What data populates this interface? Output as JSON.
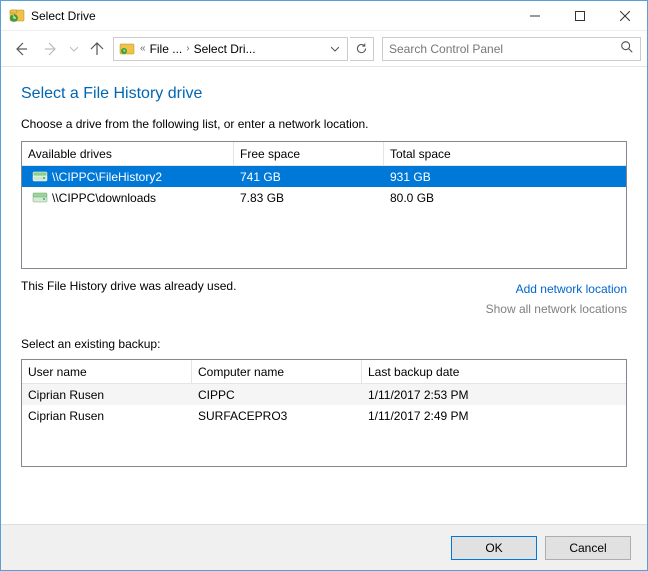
{
  "window": {
    "title": "Select Drive"
  },
  "nav": {
    "breadcrumb_seg1": "File ...",
    "breadcrumb_seg2": "Select Dri...",
    "search_placeholder": "Search Control Panel"
  },
  "page": {
    "title": "Select a File History drive",
    "instruction": "Choose a drive from the following list, or enter a network location."
  },
  "drives": {
    "headers": {
      "c1": "Available drives",
      "c2": "Free space",
      "c3": "Total space"
    },
    "rows": [
      {
        "name": "\\\\CIPPC\\FileHistory2",
        "free": "741 GB",
        "total": "931 GB",
        "selected": true
      },
      {
        "name": "\\\\CIPPC\\downloads",
        "free": "7.83 GB",
        "total": "80.0 GB",
        "selected": false
      }
    ]
  },
  "status": {
    "message": "This File History drive was already used.",
    "add_link": "Add network location",
    "show_link": "Show all network locations"
  },
  "backups": {
    "label": "Select an existing backup:",
    "headers": {
      "c1": "User name",
      "c2": "Computer name",
      "c3": "Last backup date"
    },
    "rows": [
      {
        "user": "Ciprian Rusen",
        "computer": "CIPPC",
        "date": "1/11/2017 2:53 PM"
      },
      {
        "user": "Ciprian Rusen",
        "computer": "SURFACEPRO3",
        "date": "1/11/2017 2:49 PM"
      }
    ]
  },
  "footer": {
    "ok": "OK",
    "cancel": "Cancel"
  }
}
